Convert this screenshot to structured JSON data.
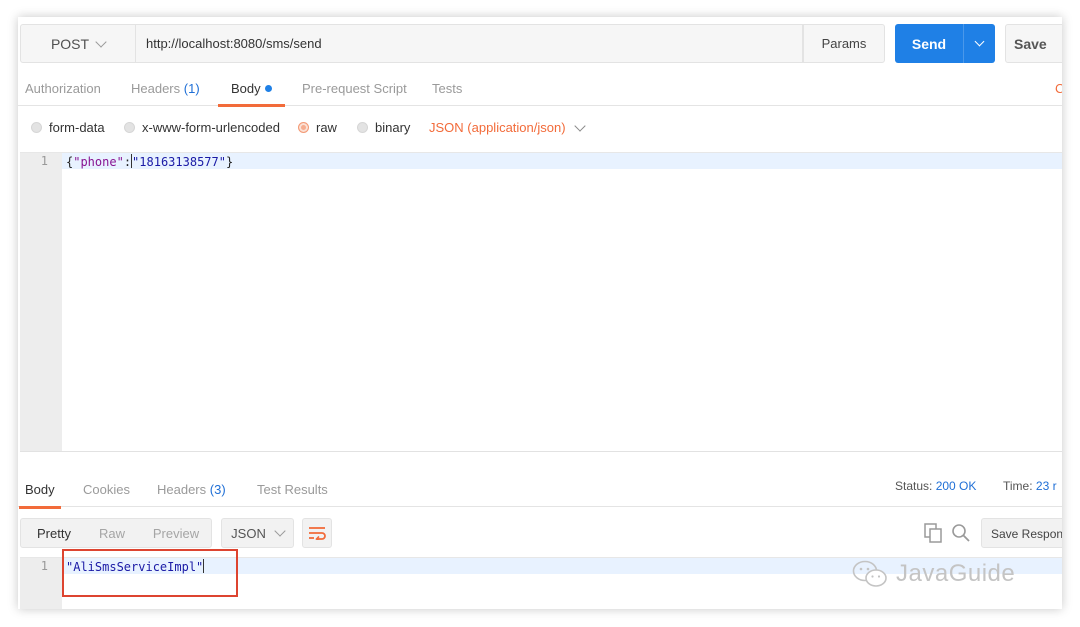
{
  "request": {
    "method": "POST",
    "url": "http://localhost:8080/sms/send",
    "params_label": "Params",
    "send_label": "Send",
    "save_label": "Save"
  },
  "request_tabs": [
    {
      "label": "Authorization",
      "count": ""
    },
    {
      "label": "Headers",
      "count": "(1)"
    },
    {
      "label": "Body",
      "count": ""
    },
    {
      "label": "Pre-request Script",
      "count": ""
    },
    {
      "label": "Tests",
      "count": ""
    }
  ],
  "active_request_tab": "Body",
  "cookies_link": "C",
  "body_types": [
    "form-data",
    "x-www-form-urlencoded",
    "raw",
    "binary"
  ],
  "selected_body_type": "raw",
  "content_type": "JSON (application/json)",
  "request_body": {
    "line_number": "1",
    "open": "{",
    "key": "\"phone\"",
    "colon": ":",
    "value": "\"18163138577\"",
    "close": "}"
  },
  "response_tabs": [
    {
      "label": "Body",
      "count": ""
    },
    {
      "label": "Cookies",
      "count": ""
    },
    {
      "label": "Headers",
      "count": "(3)"
    },
    {
      "label": "Test Results",
      "count": ""
    }
  ],
  "active_response_tab": "Body",
  "status": {
    "status_label": "Status:",
    "status_value": "200 OK",
    "time_label": "Time:",
    "time_value": "23 r"
  },
  "response_views": [
    "Pretty",
    "Raw",
    "Preview"
  ],
  "active_response_view": "Pretty",
  "response_format": "JSON",
  "save_response_label": "Save Respon",
  "response_body": {
    "line_number": "1",
    "value": "\"AliSmsServiceImpl\""
  },
  "watermark": "JavaGuide",
  "colors": {
    "accent_orange": "#f26b3a",
    "send_blue": "#1f80e6",
    "link_blue": "#1f6fd6",
    "highlight_red": "#dd4430"
  }
}
